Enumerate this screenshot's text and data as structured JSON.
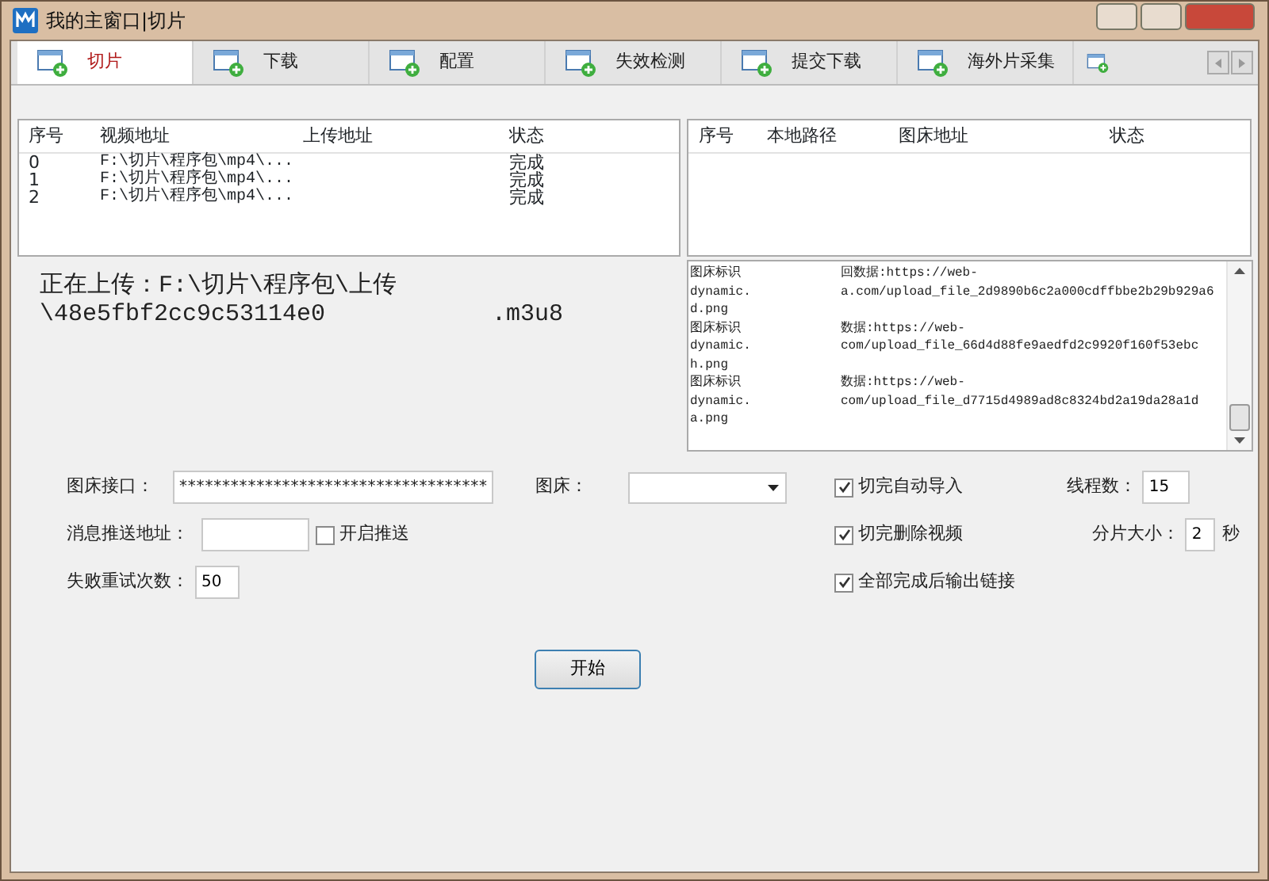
{
  "window": {
    "title": "我的主窗口|切片"
  },
  "tabs": [
    {
      "label": "切片",
      "selected": true
    },
    {
      "label": "下载",
      "selected": false
    },
    {
      "label": "配置",
      "selected": false
    },
    {
      "label": "失效检测",
      "selected": false
    },
    {
      "label": "提交下载",
      "selected": false
    },
    {
      "label": "海外片采集",
      "selected": false
    }
  ],
  "video_table": {
    "columns": [
      "序号",
      "视频地址",
      "上传地址",
      "状态"
    ],
    "rows": [
      [
        "0",
        "F:\\切片\\程序包\\mp4\\...",
        "",
        "完成"
      ],
      [
        "1",
        "F:\\切片\\程序包\\mp4\\...",
        "",
        "完成"
      ],
      [
        "2",
        "F:\\切片\\程序包\\mp4\\...",
        "",
        "完成"
      ]
    ]
  },
  "image_table": {
    "columns": [
      "序号",
      "本地路径",
      "图床地址",
      "状态"
    ]
  },
  "upload_status": {
    "line1": "正在上传：F:\\切片\\程序包\\上传",
    "line2_start": "\\48e5fbf2cc9c53114e0",
    "line2_end": ".m3u8"
  },
  "log": [
    {
      "left": "图床标识",
      "right": "回数据:https://web-"
    },
    {
      "left": "dynamic.",
      "right": "a.com/upload_file_2d9890b6c2a000cdffbbe2b29b929a6"
    },
    {
      "left": "d.png"
    },
    {
      "left": "图床标识",
      "right": "数据:https://web-"
    },
    {
      "left": "dynamic.",
      "right": "com/upload_file_66d4d88fe9aedfd2c9920f160f53ebc"
    },
    {
      "left": "h.png"
    },
    {
      "left": "图床标识",
      "right": "数据:https://web-"
    },
    {
      "left": "dynamic.",
      "right": "com/upload_file_d7715d4989ad8c8324bd2a19da28a1d"
    },
    {
      "left": "a.png"
    }
  ],
  "form": {
    "image_api": {
      "label": "图床接口：",
      "value": "************************************"
    },
    "image_host": {
      "label": "图床："
    },
    "push_url": {
      "label": "消息推送地址："
    },
    "push_enabled": {
      "label": "开启推送",
      "checked": false
    },
    "retry": {
      "label": "失败重试次数：",
      "value": "50"
    },
    "options": [
      {
        "label": "切完自动导入",
        "checked": true
      },
      {
        "label": "切完删除视频",
        "checked": true
      },
      {
        "label": "全部完成后输出链接",
        "checked": true
      }
    ],
    "threads": {
      "label": "线程数：",
      "value": "15"
    },
    "slice_size": {
      "label": "分片大小：",
      "value": "2",
      "unit": "秒"
    }
  },
  "start_button": "开始"
}
